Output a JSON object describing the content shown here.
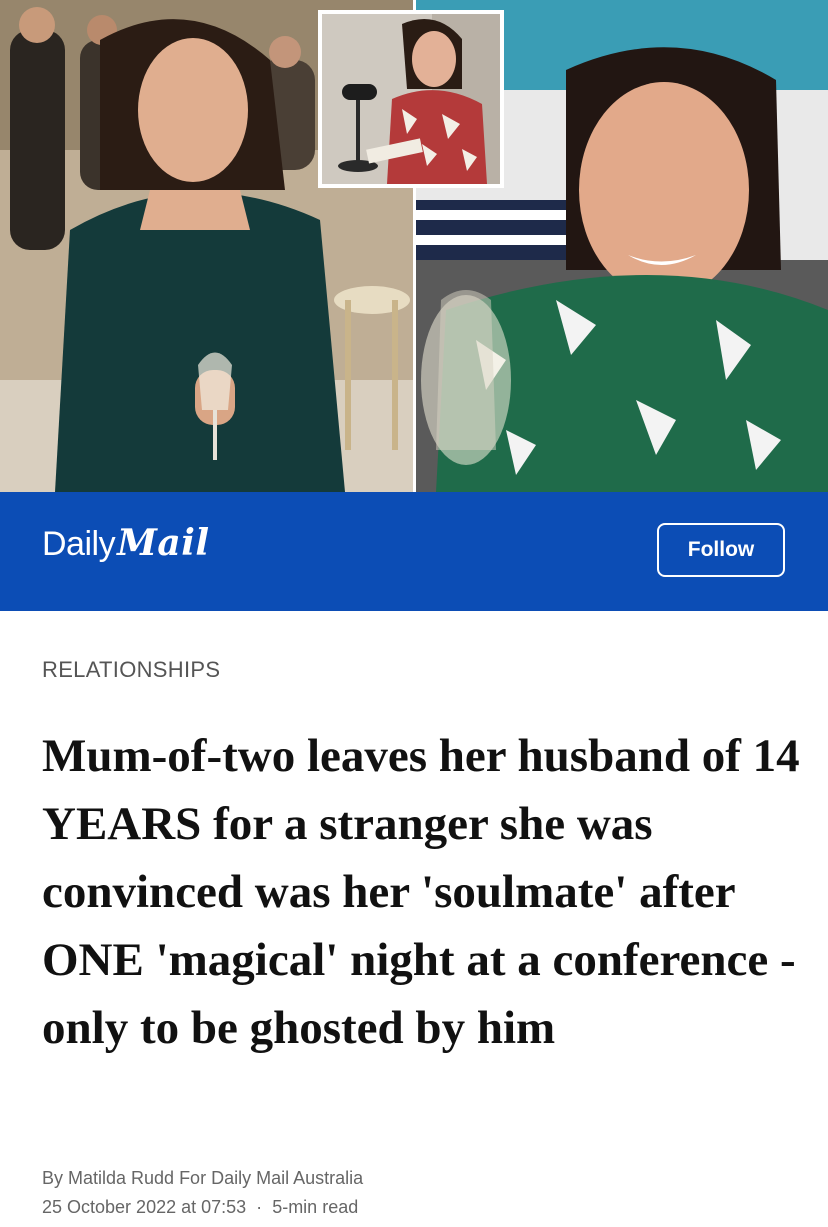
{
  "brand": {
    "name_part1": "Daily",
    "name_part2": "Mail",
    "follow_label": "Follow",
    "bar_color": "#0c4db5"
  },
  "article": {
    "category": "RELATIONSHIPS",
    "headline": "Mum-of-two leaves her husband of 14 YEARS for a stranger she was convinced was her 'soulmate' after ONE 'magical' night at a conference - only to be ghosted by him",
    "byline": "By Matilda Rudd For Daily Mail Australia",
    "date": "25 October 2022 at 07:53",
    "separator": "·",
    "read_time": "5-min read"
  }
}
